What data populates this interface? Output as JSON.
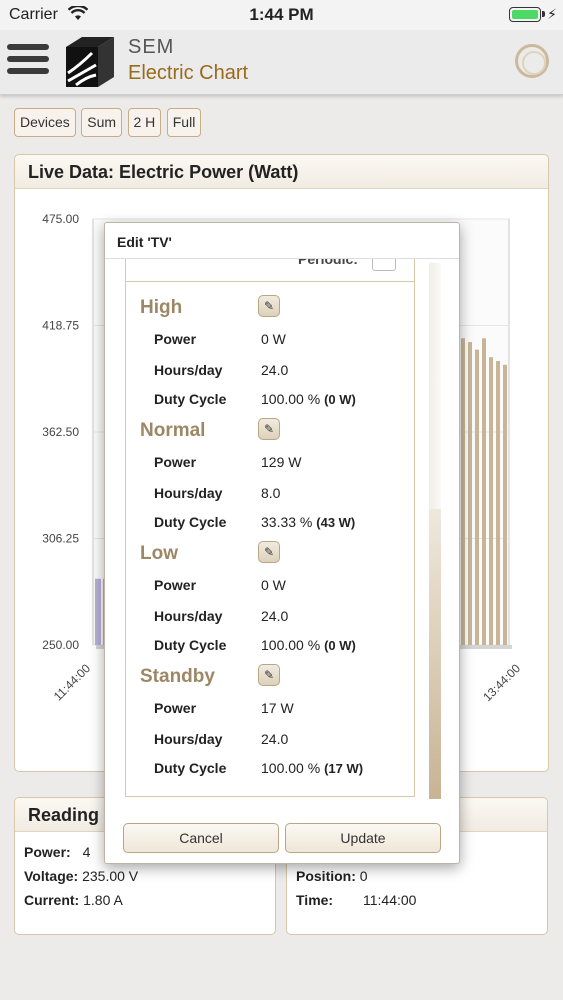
{
  "status": {
    "carrier": "Carrier",
    "time": "1:44 PM"
  },
  "app": {
    "title": "SEM",
    "subtitle": "Electric Chart"
  },
  "toolbar": [
    "Devices",
    "Sum",
    "2 H",
    "Full"
  ],
  "chart_panel": {
    "title": "Live Data: Electric Power (Watt)"
  },
  "chart_data": {
    "type": "bar",
    "title": "Live Data: Electric Power (Watt)",
    "y_ticks": [
      "475.00",
      "418.75",
      "362.50",
      "306.25",
      "250.00"
    ],
    "ylim": [
      250,
      475
    ],
    "x_ticks": [
      "11:44:00",
      "13:44:00"
    ],
    "visible_values_left": [
      285,
      285
    ],
    "visible_values_right": [
      412,
      410,
      406,
      412,
      402,
      400,
      398
    ]
  },
  "readings": {
    "title": "Reading",
    "power_label": "Power:",
    "power_value": "4",
    "voltage_label": "Voltage:",
    "voltage_value": "235.00 V",
    "current_label": "Current:",
    "current_value": "1.80 A",
    "position_label": "Position:",
    "position_value": "0",
    "time_label": "Time:",
    "time_value": "11:44:00"
  },
  "dialog": {
    "title": "Edit 'TV'",
    "periodic_label": "Periodic:",
    "power_label": "Power",
    "hours_label": "Hours/day",
    "duty_label": "Duty Cycle",
    "sections": [
      {
        "name": "High",
        "power": "0 W",
        "hours": "24.0",
        "duty": "100.00 %",
        "duty_w": "(0 W)"
      },
      {
        "name": "Normal",
        "power": "129 W",
        "hours": "8.0",
        "duty": "33.33 %",
        "duty_w": "(43 W)"
      },
      {
        "name": "Low",
        "power": "0 W",
        "hours": "24.0",
        "duty": "100.00 %",
        "duty_w": "(0 W)"
      },
      {
        "name": "Standby",
        "power": "17 W",
        "hours": "24.0",
        "duty": "100.00 %",
        "duty_w": "(17 W)"
      }
    ],
    "cancel_label": "Cancel",
    "update_label": "Update"
  },
  "colors": {
    "accent": "#9a6a1c",
    "bar": "#c7b596",
    "border": "#d8c7a8"
  }
}
